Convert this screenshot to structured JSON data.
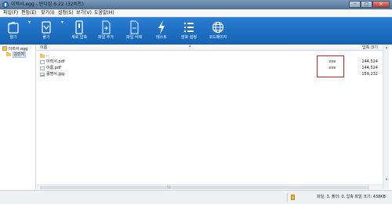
{
  "window": {
    "title": "이력서.egg - 반디집 6.22 (32비트)",
    "buttons": {
      "minimize": "─",
      "maximize": "□",
      "close": "✕"
    }
  },
  "menu": [
    "파일(F)",
    "편집(E)",
    "찾기(I)",
    "설정(S)",
    "보기(V)",
    "도움말(H)"
  ],
  "toolbar": [
    {
      "label": "열기",
      "icon": "folder-open-icon"
    },
    {
      "label": "풀기",
      "icon": "extract-icon"
    },
    {
      "label": "새로 압축",
      "icon": "new-archive-icon"
    },
    {
      "label": "파일 추가",
      "icon": "add-file-icon"
    },
    {
      "label": "파일 삭제",
      "icon": "delete-file-icon"
    },
    {
      "label": "테스트",
      "icon": "test-icon"
    },
    {
      "label": "암호 설정",
      "icon": "password-icon"
    },
    {
      "label": "코드페이지",
      "icon": "codepage-icon"
    }
  ],
  "tree": {
    "root": "이력서.egg",
    "child": "김민지"
  },
  "list": {
    "columns": {
      "name": "이름",
      "size": "압축 크기"
    },
    "rows": [
      {
        "name": "..",
        "ext": "",
        "size": ""
      },
      {
        "name": "이력서.pdf",
        "ext": ".exe",
        "size": "144,524"
      },
      {
        "name": "이름.pdf",
        "ext": ".exe",
        "size": "144,524"
      },
      {
        "name": "증명서.jpg",
        "ext": "",
        "size": "159,232"
      }
    ]
  },
  "status": {
    "text": "파일: 3, 폴더: 0, 압축 파일 크기: 438KB"
  },
  "colors": {
    "toolbar": "#1d6fc4",
    "highlight": "#d21f1f"
  }
}
